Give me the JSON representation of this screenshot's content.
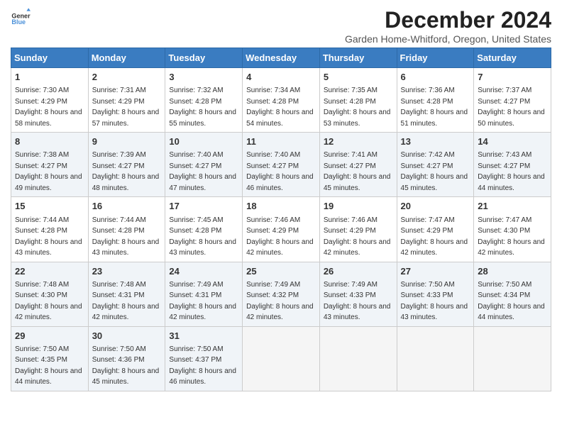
{
  "header": {
    "logo_line1": "General",
    "logo_line2": "Blue",
    "month_title": "December 2024",
    "subtitle": "Garden Home-Whitford, Oregon, United States"
  },
  "weekdays": [
    "Sunday",
    "Monday",
    "Tuesday",
    "Wednesday",
    "Thursday",
    "Friday",
    "Saturday"
  ],
  "weeks": [
    [
      {
        "day": "1",
        "sunrise": "7:30 AM",
        "sunset": "4:29 PM",
        "daylight": "8 hours and 58 minutes."
      },
      {
        "day": "2",
        "sunrise": "7:31 AM",
        "sunset": "4:29 PM",
        "daylight": "8 hours and 57 minutes."
      },
      {
        "day": "3",
        "sunrise": "7:32 AM",
        "sunset": "4:28 PM",
        "daylight": "8 hours and 55 minutes."
      },
      {
        "day": "4",
        "sunrise": "7:34 AM",
        "sunset": "4:28 PM",
        "daylight": "8 hours and 54 minutes."
      },
      {
        "day": "5",
        "sunrise": "7:35 AM",
        "sunset": "4:28 PM",
        "daylight": "8 hours and 53 minutes."
      },
      {
        "day": "6",
        "sunrise": "7:36 AM",
        "sunset": "4:28 PM",
        "daylight": "8 hours and 51 minutes."
      },
      {
        "day": "7",
        "sunrise": "7:37 AM",
        "sunset": "4:27 PM",
        "daylight": "8 hours and 50 minutes."
      }
    ],
    [
      {
        "day": "8",
        "sunrise": "7:38 AM",
        "sunset": "4:27 PM",
        "daylight": "8 hours and 49 minutes."
      },
      {
        "day": "9",
        "sunrise": "7:39 AM",
        "sunset": "4:27 PM",
        "daylight": "8 hours and 48 minutes."
      },
      {
        "day": "10",
        "sunrise": "7:40 AM",
        "sunset": "4:27 PM",
        "daylight": "8 hours and 47 minutes."
      },
      {
        "day": "11",
        "sunrise": "7:40 AM",
        "sunset": "4:27 PM",
        "daylight": "8 hours and 46 minutes."
      },
      {
        "day": "12",
        "sunrise": "7:41 AM",
        "sunset": "4:27 PM",
        "daylight": "8 hours and 45 minutes."
      },
      {
        "day": "13",
        "sunrise": "7:42 AM",
        "sunset": "4:27 PM",
        "daylight": "8 hours and 45 minutes."
      },
      {
        "day": "14",
        "sunrise": "7:43 AM",
        "sunset": "4:27 PM",
        "daylight": "8 hours and 44 minutes."
      }
    ],
    [
      {
        "day": "15",
        "sunrise": "7:44 AM",
        "sunset": "4:28 PM",
        "daylight": "8 hours and 43 minutes."
      },
      {
        "day": "16",
        "sunrise": "7:44 AM",
        "sunset": "4:28 PM",
        "daylight": "8 hours and 43 minutes."
      },
      {
        "day": "17",
        "sunrise": "7:45 AM",
        "sunset": "4:28 PM",
        "daylight": "8 hours and 43 minutes."
      },
      {
        "day": "18",
        "sunrise": "7:46 AM",
        "sunset": "4:29 PM",
        "daylight": "8 hours and 42 minutes."
      },
      {
        "day": "19",
        "sunrise": "7:46 AM",
        "sunset": "4:29 PM",
        "daylight": "8 hours and 42 minutes."
      },
      {
        "day": "20",
        "sunrise": "7:47 AM",
        "sunset": "4:29 PM",
        "daylight": "8 hours and 42 minutes."
      },
      {
        "day": "21",
        "sunrise": "7:47 AM",
        "sunset": "4:30 PM",
        "daylight": "8 hours and 42 minutes."
      }
    ],
    [
      {
        "day": "22",
        "sunrise": "7:48 AM",
        "sunset": "4:30 PM",
        "daylight": "8 hours and 42 minutes."
      },
      {
        "day": "23",
        "sunrise": "7:48 AM",
        "sunset": "4:31 PM",
        "daylight": "8 hours and 42 minutes."
      },
      {
        "day": "24",
        "sunrise": "7:49 AM",
        "sunset": "4:31 PM",
        "daylight": "8 hours and 42 minutes."
      },
      {
        "day": "25",
        "sunrise": "7:49 AM",
        "sunset": "4:32 PM",
        "daylight": "8 hours and 42 minutes."
      },
      {
        "day": "26",
        "sunrise": "7:49 AM",
        "sunset": "4:33 PM",
        "daylight": "8 hours and 43 minutes."
      },
      {
        "day": "27",
        "sunrise": "7:50 AM",
        "sunset": "4:33 PM",
        "daylight": "8 hours and 43 minutes."
      },
      {
        "day": "28",
        "sunrise": "7:50 AM",
        "sunset": "4:34 PM",
        "daylight": "8 hours and 44 minutes."
      }
    ],
    [
      {
        "day": "29",
        "sunrise": "7:50 AM",
        "sunset": "4:35 PM",
        "daylight": "8 hours and 44 minutes."
      },
      {
        "day": "30",
        "sunrise": "7:50 AM",
        "sunset": "4:36 PM",
        "daylight": "8 hours and 45 minutes."
      },
      {
        "day": "31",
        "sunrise": "7:50 AM",
        "sunset": "4:37 PM",
        "daylight": "8 hours and 46 minutes."
      },
      null,
      null,
      null,
      null
    ]
  ],
  "labels": {
    "sunrise": "Sunrise:",
    "sunset": "Sunset:",
    "daylight": "Daylight:"
  }
}
